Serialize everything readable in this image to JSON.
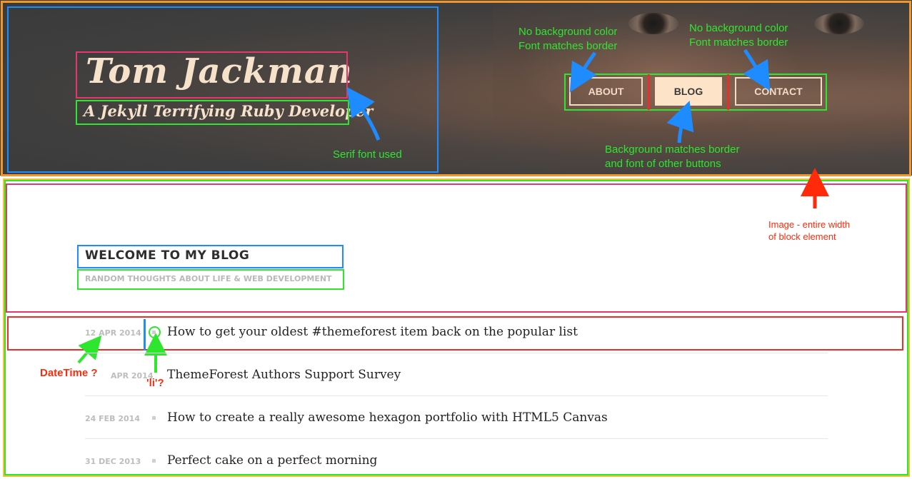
{
  "header": {
    "title": "Tom Jackman",
    "subtitle": "A Jekyll Terrifying Ruby Developer",
    "nav": [
      {
        "label": "ABOUT",
        "active": false
      },
      {
        "label": "BLOG",
        "active": true
      },
      {
        "label": "CONTACT",
        "active": false
      }
    ]
  },
  "blog": {
    "heading": "WELCOME TO MY BLOG",
    "subheading": "RANDOM THOUGHTS ABOUT LIFE & WEB DEVELOPMENT",
    "posts": [
      {
        "date": "12 APR 2014",
        "title": "How to get your oldest #themeforest item back on the popular list"
      },
      {
        "date": "APR 2014",
        "title": "ThemeForest Authors Support Survey"
      },
      {
        "date": "24 FEB 2014",
        "title": "How to create a really awesome hexagon portfolio with HTML5 Canvas"
      },
      {
        "date": "31 DEC 2013",
        "title": "Perfect cake on a perfect morning"
      }
    ]
  },
  "annotations": {
    "about_note": "No background color\nFont matches border",
    "contact_note": "No background color\nFont matches border",
    "blog_note": "Background matches border\nand font of other buttons",
    "serif_note": "Serif font used",
    "image_note": "Image - entire width\nof block element",
    "datetime_note": "DateTime ?",
    "li_note": "'li'?"
  },
  "colors": {
    "accent_cream": "#f6e1cb",
    "annotation_green": "#2ee62e",
    "annotation_red": "#ff2a0a",
    "annotation_blue": "#1e8cff",
    "outline_orange": "#f0962a",
    "outline_pink": "#e8356e"
  }
}
